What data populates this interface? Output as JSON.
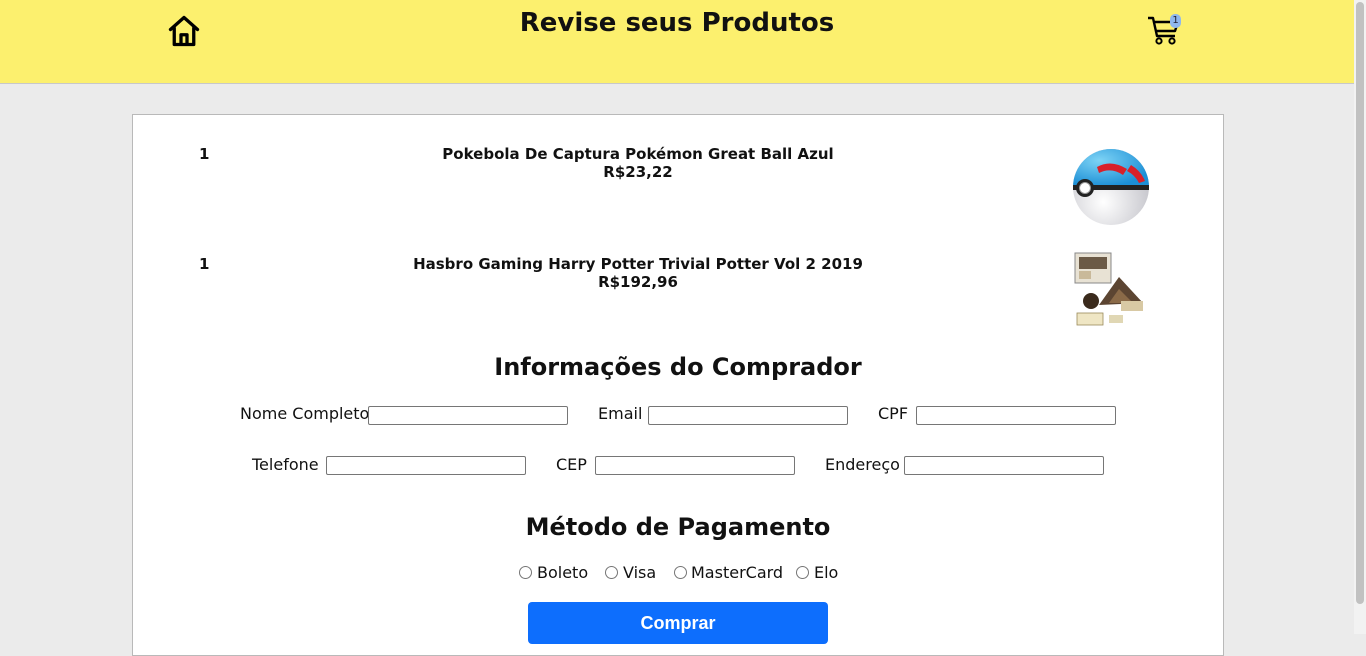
{
  "header": {
    "title": "Revise seus Produtos",
    "cart_count": "1"
  },
  "items": [
    {
      "qty": "1",
      "name": "Pokebola De Captura Pokémon Great Ball Azul",
      "price": "R$23,22"
    },
    {
      "qty": "1",
      "name": "Hasbro Gaming Harry Potter Trivial Potter Vol 2 2019",
      "price": "R$192,96"
    }
  ],
  "buyer": {
    "title": "Informações do Comprador",
    "fields": {
      "name": {
        "label": "Nome Completo",
        "value": ""
      },
      "email": {
        "label": "Email",
        "value": ""
      },
      "cpf": {
        "label": "CPF",
        "value": ""
      },
      "phone": {
        "label": "Telefone",
        "value": ""
      },
      "cep": {
        "label": "CEP",
        "value": ""
      },
      "address": {
        "label": "Endereço",
        "value": ""
      }
    }
  },
  "payment": {
    "title": "Método de Pagamento",
    "options": [
      "Boleto",
      "Visa",
      "MasterCard",
      "Elo"
    ],
    "submit_label": "Comprar"
  },
  "icons": {
    "home": "home-icon",
    "cart": "shopping-cart-icon"
  },
  "colors": {
    "header_bg": "#fcf06e",
    "button_bg": "#0d6efd",
    "page_bg": "#ebebeb"
  }
}
